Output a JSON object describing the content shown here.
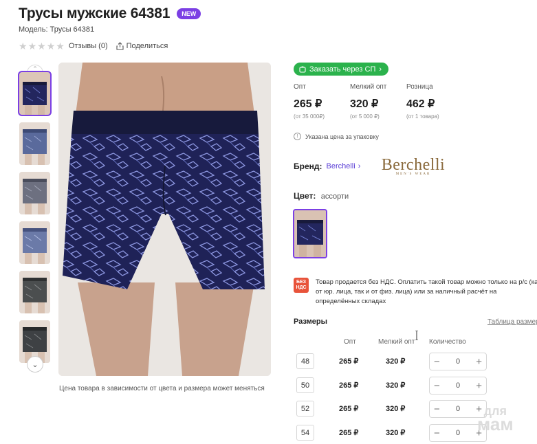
{
  "product": {
    "title": "Трусы мужские 64381",
    "badge": "NEW",
    "model": "Модель: Трусы 64381",
    "reviews": "Отзывы (0)",
    "share": "Поделиться",
    "photo_note": "Цена товара в зависимости от цвета и размера может меняться"
  },
  "order_button": "Заказать через СП",
  "prices": [
    {
      "label": "Опт",
      "value": "265 ₽",
      "sub": "(от 35 000₽)"
    },
    {
      "label": "Мелкий опт",
      "value": "320 ₽",
      "sub": "(от 5 000 ₽)"
    },
    {
      "label": "Розница",
      "value": "462 ₽",
      "sub": "(от 1 товара)"
    }
  ],
  "pack_note": "Указана цена за упаковку",
  "brand": {
    "label": "Бренд:",
    "name": "Berchelli",
    "logo_text": "Berchelli",
    "logo_sub": "MEN'S WEAR"
  },
  "color": {
    "label": "Цвет:",
    "value": "ассорти"
  },
  "vat": {
    "icon_line1": "БЕЗ",
    "icon_line2": "НДС",
    "text": "Товар продается без НДС. Оплатить такой товар можно только на р/с (как от юр. лица, так и от физ. лица) или за наличный расчёт на определённых складах"
  },
  "sizes": {
    "title": "Размеры",
    "table_link": "Таблица размеров",
    "headers": {
      "opt": "Опт",
      "small": "Мелкий опт",
      "qty": "Количество"
    },
    "rows": [
      {
        "size": "48",
        "opt": "265 ₽",
        "small": "320 ₽",
        "qty": "0"
      },
      {
        "size": "50",
        "opt": "265 ₽",
        "small": "320 ₽",
        "qty": "0"
      },
      {
        "size": "52",
        "opt": "265 ₽",
        "small": "320 ₽",
        "qty": "0"
      },
      {
        "size": "54",
        "opt": "265 ₽",
        "small": "320 ₽",
        "qty": "0"
      }
    ]
  },
  "watermark": {
    "line1": "для",
    "line2": "мам"
  },
  "colors": {
    "accent": "#7b3fe4",
    "green": "#2bb24c",
    "brand_link": "#5b3fd6",
    "vat_red": "#e8533a",
    "navy_fabric": "#1f2257"
  },
  "icons": {
    "share": "share-icon",
    "cart": "cart-icon",
    "info": "info-icon",
    "chevron_up": "chevron-up-icon",
    "chevron_down": "chevron-down-icon"
  }
}
